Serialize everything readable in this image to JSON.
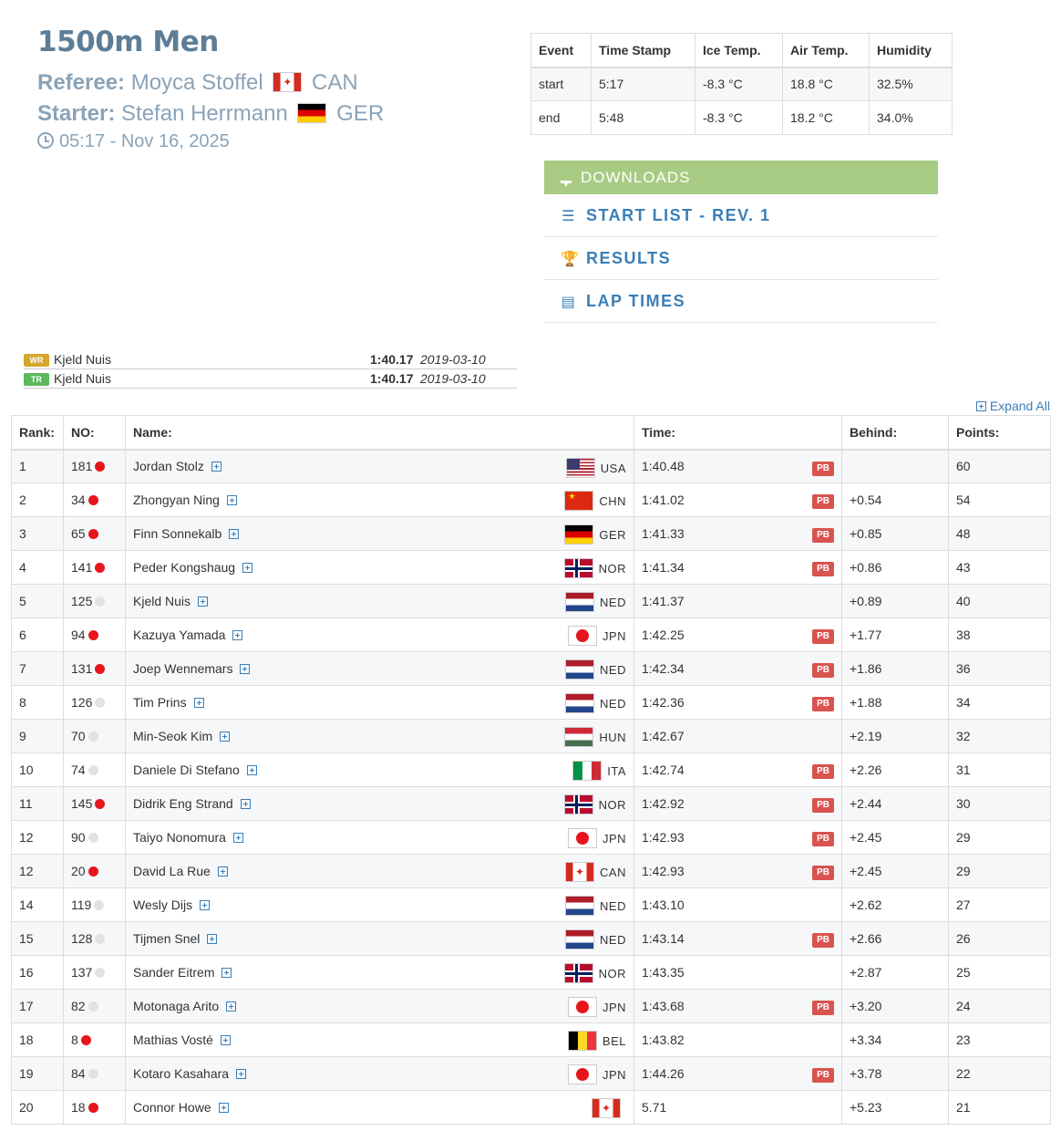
{
  "header": {
    "title": "1500m Men",
    "referee_label": "Referee:",
    "referee_name": "Moyca Stoffel",
    "referee_country": "CAN",
    "starter_label": "Starter:",
    "starter_name": "Stefan Herrmann",
    "starter_country": "GER",
    "datetime": "05:17 - Nov 16, 2025"
  },
  "conditions": {
    "headers": [
      "Event",
      "Time Stamp",
      "Ice Temp.",
      "Air Temp.",
      "Humidity"
    ],
    "rows": [
      [
        "start",
        "5:17",
        "-8.3 °C",
        "18.8 °C",
        "32.5%"
      ],
      [
        "end",
        "5:48",
        "-8.3 °C",
        "18.2 °C",
        "34.0%"
      ]
    ]
  },
  "downloads": {
    "title": "DOWNLOADS",
    "items": [
      "START LIST - REV. 1",
      "RESULTS",
      "LAP TIMES"
    ]
  },
  "records": [
    {
      "badge": "WR",
      "name": "Kjeld Nuis",
      "time": "1:40.17",
      "date": "2019-03-10"
    },
    {
      "badge": "TR",
      "name": "Kjeld Nuis",
      "time": "1:40.17",
      "date": "2019-03-10"
    }
  ],
  "expand_all": "Expand All",
  "results": {
    "headers": [
      "Rank:",
      "NO:",
      "Name:",
      "Time:",
      "Behind:",
      "Points:"
    ],
    "pb_label": "PB",
    "rows": [
      {
        "rank": "1",
        "no": "181",
        "dot": "red",
        "name": "Jordan Stolz",
        "country": "USA",
        "flag": "f-usa",
        "time": "1:40.48",
        "pb": true,
        "behind": "",
        "points": "60"
      },
      {
        "rank": "2",
        "no": "34",
        "dot": "red",
        "name": "Zhongyan Ning",
        "country": "CHN",
        "flag": "f-chn",
        "time": "1:41.02",
        "pb": true,
        "behind": "+0.54",
        "points": "54"
      },
      {
        "rank": "3",
        "no": "65",
        "dot": "red",
        "name": "Finn Sonnekalb",
        "country": "GER",
        "flag": "f-ger",
        "time": "1:41.33",
        "pb": true,
        "behind": "+0.85",
        "points": "48"
      },
      {
        "rank": "4",
        "no": "141",
        "dot": "red",
        "name": "Peder Kongshaug",
        "country": "NOR",
        "flag": "f-nor",
        "time": "1:41.34",
        "pb": true,
        "behind": "+0.86",
        "points": "43"
      },
      {
        "rank": "5",
        "no": "125",
        "dot": "grey",
        "name": "Kjeld Nuis",
        "country": "NED",
        "flag": "f-ned",
        "time": "1:41.37",
        "pb": false,
        "behind": "+0.89",
        "points": "40"
      },
      {
        "rank": "6",
        "no": "94",
        "dot": "red",
        "name": "Kazuya Yamada",
        "country": "JPN",
        "flag": "f-jpn",
        "time": "1:42.25",
        "pb": true,
        "behind": "+1.77",
        "points": "38"
      },
      {
        "rank": "7",
        "no": "131",
        "dot": "red",
        "name": "Joep Wennemars",
        "country": "NED",
        "flag": "f-ned",
        "time": "1:42.34",
        "pb": true,
        "behind": "+1.86",
        "points": "36"
      },
      {
        "rank": "8",
        "no": "126",
        "dot": "grey",
        "name": "Tim Prins",
        "country": "NED",
        "flag": "f-ned",
        "time": "1:42.36",
        "pb": true,
        "behind": "+1.88",
        "points": "34"
      },
      {
        "rank": "9",
        "no": "70",
        "dot": "grey",
        "name": "Min-Seok Kim",
        "country": "HUN",
        "flag": "f-hun",
        "time": "1:42.67",
        "pb": false,
        "behind": "+2.19",
        "points": "32"
      },
      {
        "rank": "10",
        "no": "74",
        "dot": "grey",
        "name": "Daniele Di Stefano",
        "country": "ITA",
        "flag": "f-ita",
        "time": "1:42.74",
        "pb": true,
        "behind": "+2.26",
        "points": "31"
      },
      {
        "rank": "11",
        "no": "145",
        "dot": "red",
        "name": "Didrik Eng Strand",
        "country": "NOR",
        "flag": "f-nor",
        "time": "1:42.92",
        "pb": true,
        "behind": "+2.44",
        "points": "30"
      },
      {
        "rank": "12",
        "no": "90",
        "dot": "grey",
        "name": "Taiyo Nonomura",
        "country": "JPN",
        "flag": "f-jpn",
        "time": "1:42.93",
        "pb": true,
        "behind": "+2.45",
        "points": "29"
      },
      {
        "rank": "12",
        "no": "20",
        "dot": "red",
        "name": "David La Rue",
        "country": "CAN",
        "flag": "f-can",
        "time": "1:42.93",
        "pb": true,
        "behind": "+2.45",
        "points": "29"
      },
      {
        "rank": "14",
        "no": "119",
        "dot": "grey",
        "name": "Wesly Dijs",
        "country": "NED",
        "flag": "f-ned",
        "time": "1:43.10",
        "pb": false,
        "behind": "+2.62",
        "points": "27"
      },
      {
        "rank": "15",
        "no": "128",
        "dot": "grey",
        "name": "Tijmen Snel",
        "country": "NED",
        "flag": "f-ned",
        "time": "1:43.14",
        "pb": true,
        "behind": "+2.66",
        "points": "26"
      },
      {
        "rank": "16",
        "no": "137",
        "dot": "grey",
        "name": "Sander Eitrem",
        "country": "NOR",
        "flag": "f-nor",
        "time": "1:43.35",
        "pb": false,
        "behind": "+2.87",
        "points": "25"
      },
      {
        "rank": "17",
        "no": "82",
        "dot": "grey",
        "name": "Motonaga Arito",
        "country": "JPN",
        "flag": "f-jpn",
        "time": "1:43.68",
        "pb": true,
        "behind": "+3.20",
        "points": "24"
      },
      {
        "rank": "18",
        "no": "8",
        "dot": "red",
        "name": "Mathias Vosté",
        "country": "BEL",
        "flag": "f-bel",
        "time": "1:43.82",
        "pb": false,
        "behind": "+3.34",
        "points": "23"
      },
      {
        "rank": "19",
        "no": "84",
        "dot": "grey",
        "name": "Kotaro Kasahara",
        "country": "JPN",
        "flag": "f-jpn",
        "time": "1:44.26",
        "pb": true,
        "behind": "+3.78",
        "points": "22"
      },
      {
        "rank": "20",
        "no": "18",
        "dot": "red",
        "name": "Connor Howe",
        "country": "",
        "flag": "f-can",
        "time": "5.71",
        "pb": false,
        "behind": "+5.23",
        "points": "21"
      }
    ]
  }
}
